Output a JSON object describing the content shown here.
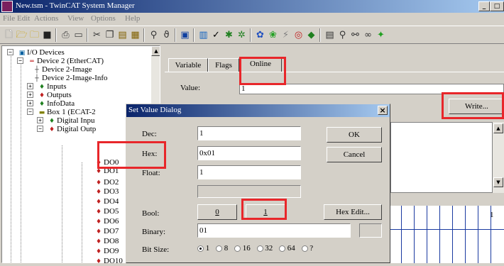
{
  "window": {
    "title": "New.tsm - TwinCAT System Manager",
    "min_label": "_",
    "max_label": "□"
  },
  "menu": [
    "File",
    "Edit",
    "Actions",
    "View",
    "Options",
    "Help"
  ],
  "toolbar": [
    "new-icon",
    "open-icon",
    "open-folder-icon",
    "save-icon",
    "print-icon",
    "print-preview-icon",
    "cut-icon",
    "copy-icon",
    "paste-icon",
    "paste-special-icon",
    "find-icon",
    "find-next-icon",
    "grid-icon",
    "generate-mappings-icon",
    "check-icon",
    "activate-config-icon",
    "set-run-mode-icon",
    "login-icon",
    "config-mode-icon",
    "scan-icon",
    "target-icon",
    "zoom-icon",
    "toggle-icon",
    "search-icon",
    "link-icon",
    "glasses-icon",
    "green-icon"
  ],
  "tree": {
    "items": [
      {
        "label": "I/O Devices",
        "icon": "io-devices-icon",
        "expander": "−"
      },
      {
        "label": "Device 2 (EtherCAT)",
        "icon": "ethercat-device-icon",
        "expander": "−"
      },
      {
        "label": "Device 2-Image",
        "icon": "image-icon",
        "expander": ""
      },
      {
        "label": "Device 2-Image-Info",
        "icon": "image-icon",
        "expander": ""
      },
      {
        "label": "Inputs",
        "icon": "inputs-icon",
        "expander": "+"
      },
      {
        "label": "Outputs",
        "icon": "outputs-icon",
        "expander": "+"
      },
      {
        "label": "InfoData",
        "icon": "infodata-icon",
        "expander": "+"
      },
      {
        "label": "Box 1 (ECAT-2",
        "icon": "box-icon",
        "expander": "−"
      },
      {
        "label": "Digital Inpu",
        "icon": "digital-input-icon",
        "expander": "+"
      },
      {
        "label": "Digital Outp",
        "icon": "digital-output-icon",
        "expander": "−"
      },
      {
        "label": "DO0",
        "icon": "do-channel-icon",
        "expander": ""
      },
      {
        "label": "DO1",
        "icon": "do-channel-icon",
        "expander": ""
      },
      {
        "label": "DO2",
        "icon": "do-channel-icon",
        "expander": ""
      },
      {
        "label": "DO3",
        "icon": "do-channel-icon",
        "expander": ""
      },
      {
        "label": "DO4",
        "icon": "do-channel-icon",
        "expander": ""
      },
      {
        "label": "DO5",
        "icon": "do-channel-icon",
        "expander": ""
      },
      {
        "label": "DO6",
        "icon": "do-channel-icon",
        "expander": ""
      },
      {
        "label": "DO7",
        "icon": "do-channel-icon",
        "expander": ""
      },
      {
        "label": "DO8",
        "icon": "do-channel-icon",
        "expander": ""
      },
      {
        "label": "DO9",
        "icon": "do-channel-icon",
        "expander": ""
      },
      {
        "label": "DO10",
        "icon": "do-channel-icon",
        "expander": ""
      }
    ]
  },
  "tabs": [
    {
      "label": "Variable"
    },
    {
      "label": "Flags"
    },
    {
      "label": "Online"
    }
  ],
  "online": {
    "value_label": "Value:",
    "value": "1",
    "write_button": "Write..."
  },
  "grid": {
    "cell_value": "1"
  },
  "dialog": {
    "title": "Set Value Dialog",
    "close_label": "×",
    "dec_label": "Dec:",
    "dec_value": "1",
    "hex_label": "Hex:",
    "hex_value": "0x01",
    "float_label": "Float:",
    "float_value": "1",
    "ok_label": "OK",
    "cancel_label": "Cancel",
    "bool_label": "Bool:",
    "bool_0": "0",
    "bool_1": "1",
    "hex_edit_label": "Hex Edit...",
    "binary_label": "Binary:",
    "binary_value": "01",
    "bitsize_label": "Bit Size:",
    "bitsizes": [
      "1",
      "8",
      "16",
      "32",
      "64",
      "?"
    ],
    "bitsize_selected": "1"
  },
  "colors": {
    "highlight": "#e8262a",
    "titlebar": "#0a246a",
    "chrome": "#d4d0c8"
  }
}
